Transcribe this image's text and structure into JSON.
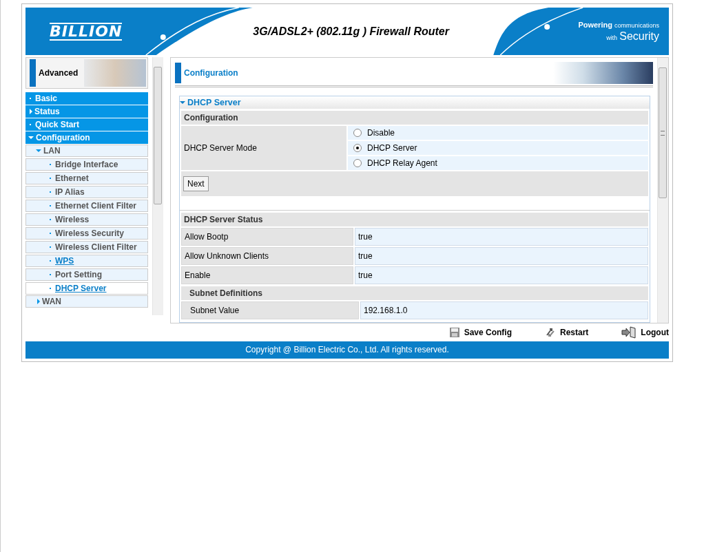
{
  "header": {
    "logo": "BILLION",
    "title": "3G/ADSL2+ (802.11g ) Firewall Router",
    "slogan_top": "Powering",
    "slogan_small": "communications",
    "slogan_with": "with",
    "slogan_big": "Security"
  },
  "sidebar": {
    "heading": "Advanced",
    "items": [
      {
        "label": "Basic",
        "kind": "leaf",
        "selected": false,
        "linked": false
      },
      {
        "label": "Status",
        "kind": "group",
        "expanded": false
      },
      {
        "label": "Quick Start",
        "kind": "leaf",
        "selected": false,
        "linked": false
      },
      {
        "label": "Configuration",
        "kind": "group",
        "expanded": true,
        "children": [
          {
            "label": "LAN",
            "kind": "group",
            "expanded": true,
            "children": [
              {
                "label": "Bridge Interface",
                "kind": "leaf",
                "selected": false,
                "linked": false
              },
              {
                "label": "Ethernet",
                "kind": "leaf",
                "selected": false,
                "linked": false
              },
              {
                "label": "IP Alias",
                "kind": "leaf",
                "selected": false,
                "linked": false
              },
              {
                "label": "Ethernet Client Filter",
                "kind": "leaf",
                "selected": false,
                "linked": false
              },
              {
                "label": "Wireless",
                "kind": "leaf",
                "selected": false,
                "linked": false
              },
              {
                "label": "Wireless Security",
                "kind": "leaf",
                "selected": false,
                "linked": false
              },
              {
                "label": "Wireless Client Filter",
                "kind": "leaf",
                "selected": false,
                "linked": false
              },
              {
                "label": "WPS",
                "kind": "leaf",
                "selected": false,
                "linked": true
              },
              {
                "label": "Port Setting",
                "kind": "leaf",
                "selected": false,
                "linked": false
              },
              {
                "label": "DHCP Server",
                "kind": "leaf",
                "selected": true,
                "linked": true
              }
            ]
          },
          {
            "label": "WAN",
            "kind": "group",
            "expanded": false
          }
        ]
      }
    ]
  },
  "content": {
    "title": "Configuration",
    "section": "DHCP Server",
    "section_expanded": true,
    "config_heading": "Configuration",
    "mode_label": "DHCP Server Mode",
    "mode_options": [
      {
        "label": "Disable",
        "selected": false
      },
      {
        "label": "DHCP Server",
        "selected": true
      },
      {
        "label": "DHCP Relay Agent",
        "selected": false
      }
    ],
    "next_button": "Next",
    "status_heading": "DHCP Server Status",
    "status_rows": [
      {
        "kind": "row",
        "label": "Allow Bootp",
        "value": "true"
      },
      {
        "kind": "row",
        "label": "Allow Unknown Clients",
        "value": "true"
      },
      {
        "kind": "row",
        "label": "Enable",
        "value": "true"
      },
      {
        "kind": "subheading",
        "label": "Subnet Definitions"
      },
      {
        "kind": "subrow",
        "label": "Subnet Value",
        "value": "192.168.1.0"
      }
    ]
  },
  "footer": {
    "actions": [
      {
        "kind": "save",
        "label": "Save Config"
      },
      {
        "kind": "restart",
        "label": "Restart"
      },
      {
        "kind": "logout",
        "label": "Logout"
      }
    ],
    "copyright": "Copyright @ Billion Electric Co., Ltd. All rights reserved."
  }
}
